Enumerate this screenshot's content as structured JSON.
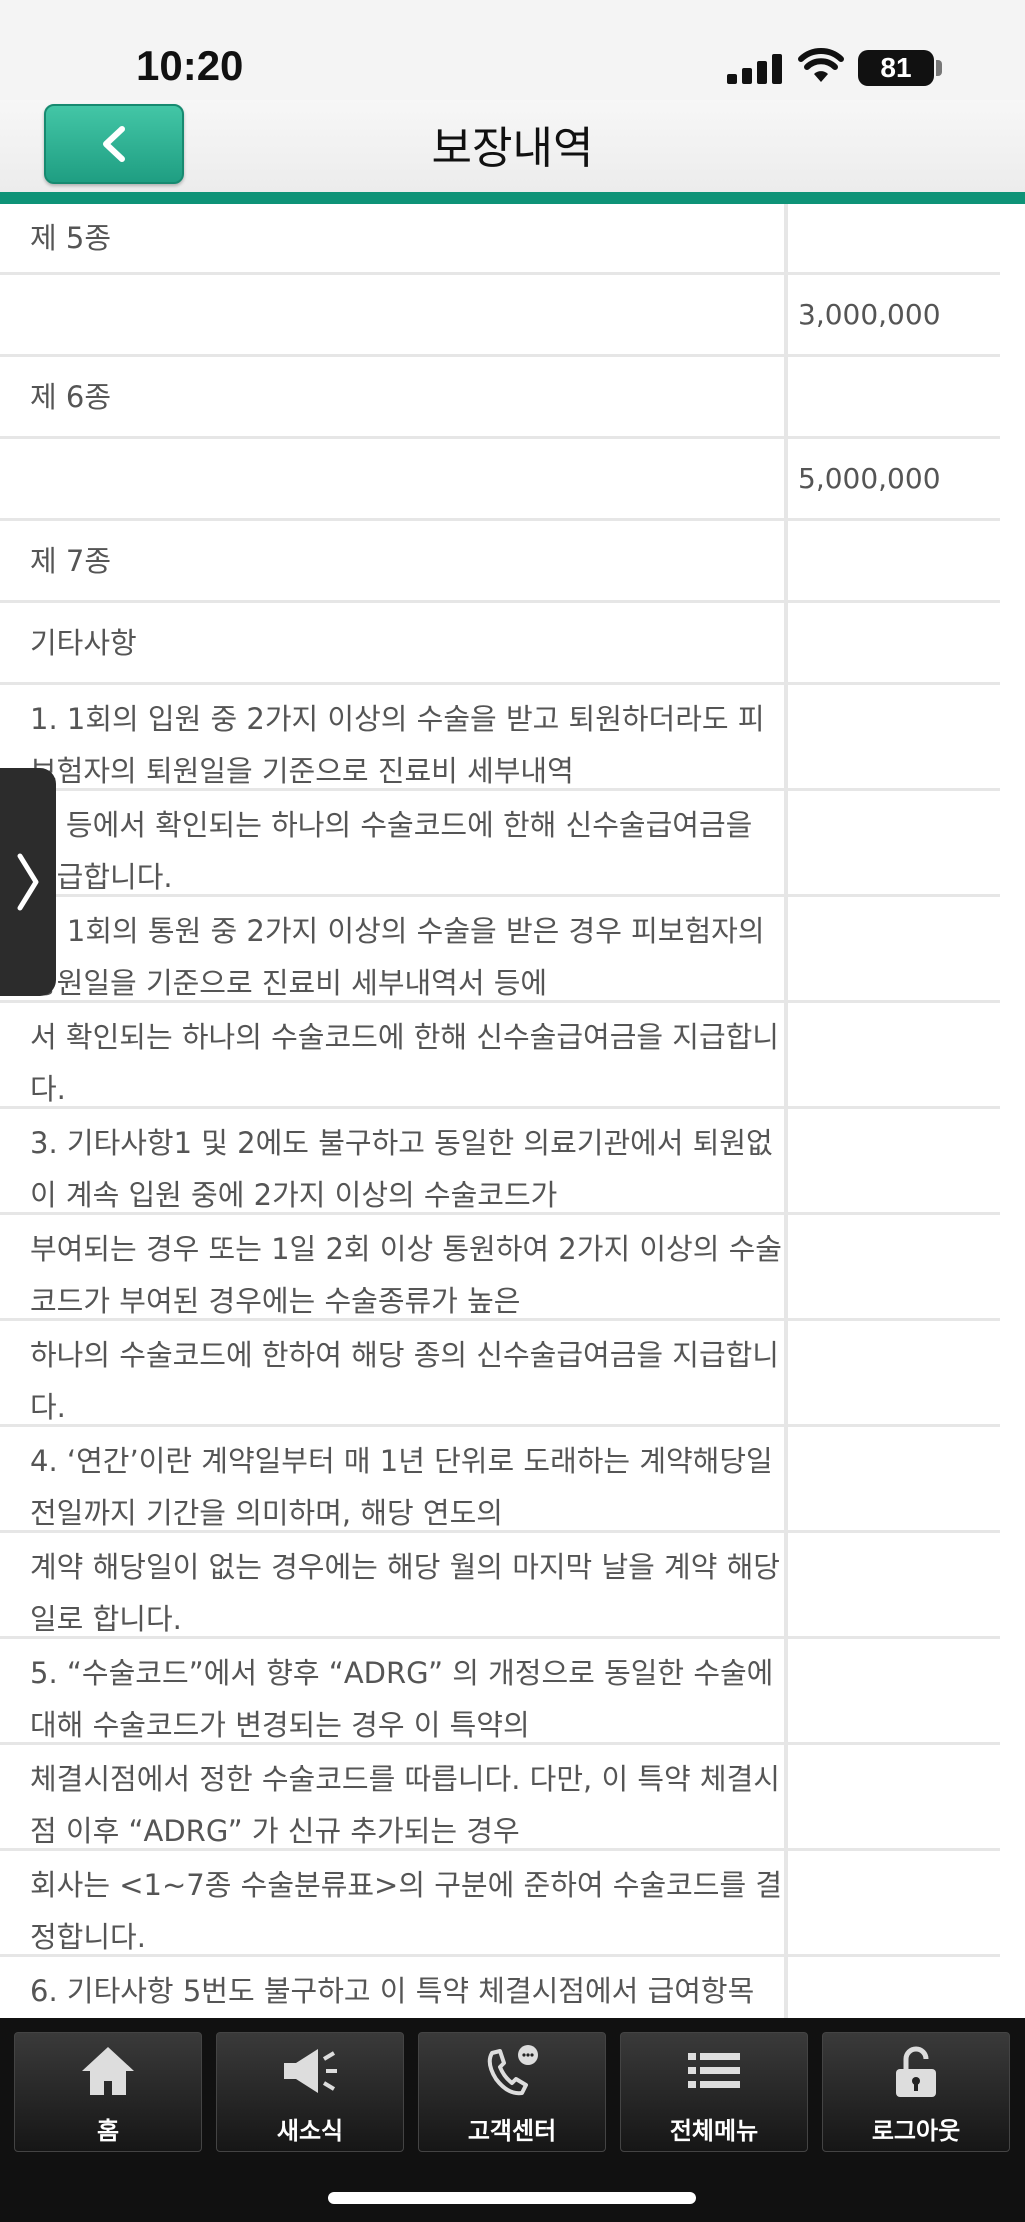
{
  "status_bar": {
    "time": "10:20",
    "battery": "81"
  },
  "header": {
    "title": "보장내역"
  },
  "table": {
    "rows": [
      {
        "left": "제 5종",
        "right": ""
      },
      {
        "left": "",
        "right": "3,000,000"
      },
      {
        "left": "제 6종",
        "right": ""
      },
      {
        "left": "",
        "right": "5,000,000"
      },
      {
        "left": "제 7종",
        "right": ""
      },
      {
        "left": "기타사항",
        "right": ""
      },
      {
        "left": "1. 1회의 입원 중 2가지 이상의 수술을 받고 퇴원하더라도 피보험자의 퇴원일을 기준으로 진료비 세부내역",
        "right": ""
      },
      {
        "left": "서 등에서 확인되는 하나의 수술코드에 한해 신수술급여금을 지급합니다.",
        "right": ""
      },
      {
        "left": "2. 1회의 통원 중 2가지 이상의 수술을 받은 경우 피보험자의 통원일을 기준으로 진료비 세부내역서 등에",
        "right": ""
      },
      {
        "left": "서 확인되는 하나의 수술코드에 한해 신수술급여금을 지급합니다.",
        "right": ""
      },
      {
        "left": "3. 기타사항1 및 2에도 불구하고  동일한 의료기관에서 퇴원없이 계속 입원 중에 2가지 이상의 수술코드가",
        "right": ""
      },
      {
        "left": "부여되는 경우 또는 1일 2회 이상 통원하여 2가지 이상의 수술코드가 부여된 경우에는 수술종류가 높은",
        "right": ""
      },
      {
        "left": "하나의 수술코드에 한하여 해당 종의 신수술급여금을 지급합니다.",
        "right": ""
      },
      {
        "left": "4. ‘연간’이란 계약일부터 매 1년 단위로 도래하는 계약해당일 전일까지 기간을 의미하며, 해당 연도의",
        "right": ""
      },
      {
        "left": "계약 해당일이 없는 경우에는 해당 월의 마지막 날을 계약 해당일로 합니다.",
        "right": ""
      },
      {
        "left": "5. “수술코드”에서 향후 “ADRG” 의 개정으로 동일한 수술에 대해 수술코드가 변경되는 경우 이 특약의",
        "right": ""
      },
      {
        "left": "체결시점에서 정한 수술코드를 따릅니다. 다만, 이 특약 체결시점 이후 “ADRG” 가 신규 추가되는 경우",
        "right": ""
      },
      {
        "left": "회사는 <1~7종 수술분류표>의 구분에 준하여 수술코드를 결정합니다.",
        "right": ""
      },
      {
        "left": "6. 기타사항 5번도 불구하고 이 특약 체결시점에서 급여항목",
        "right": ""
      }
    ]
  },
  "bottom_nav": [
    {
      "label": "홈",
      "icon": "home-icon"
    },
    {
      "label": "새소식",
      "icon": "megaphone-icon"
    },
    {
      "label": "고객센터",
      "icon": "phone-chat-icon"
    },
    {
      "label": "전체메뉴",
      "icon": "list-menu-icon"
    },
    {
      "label": "로그아웃",
      "icon": "lock-icon"
    }
  ]
}
